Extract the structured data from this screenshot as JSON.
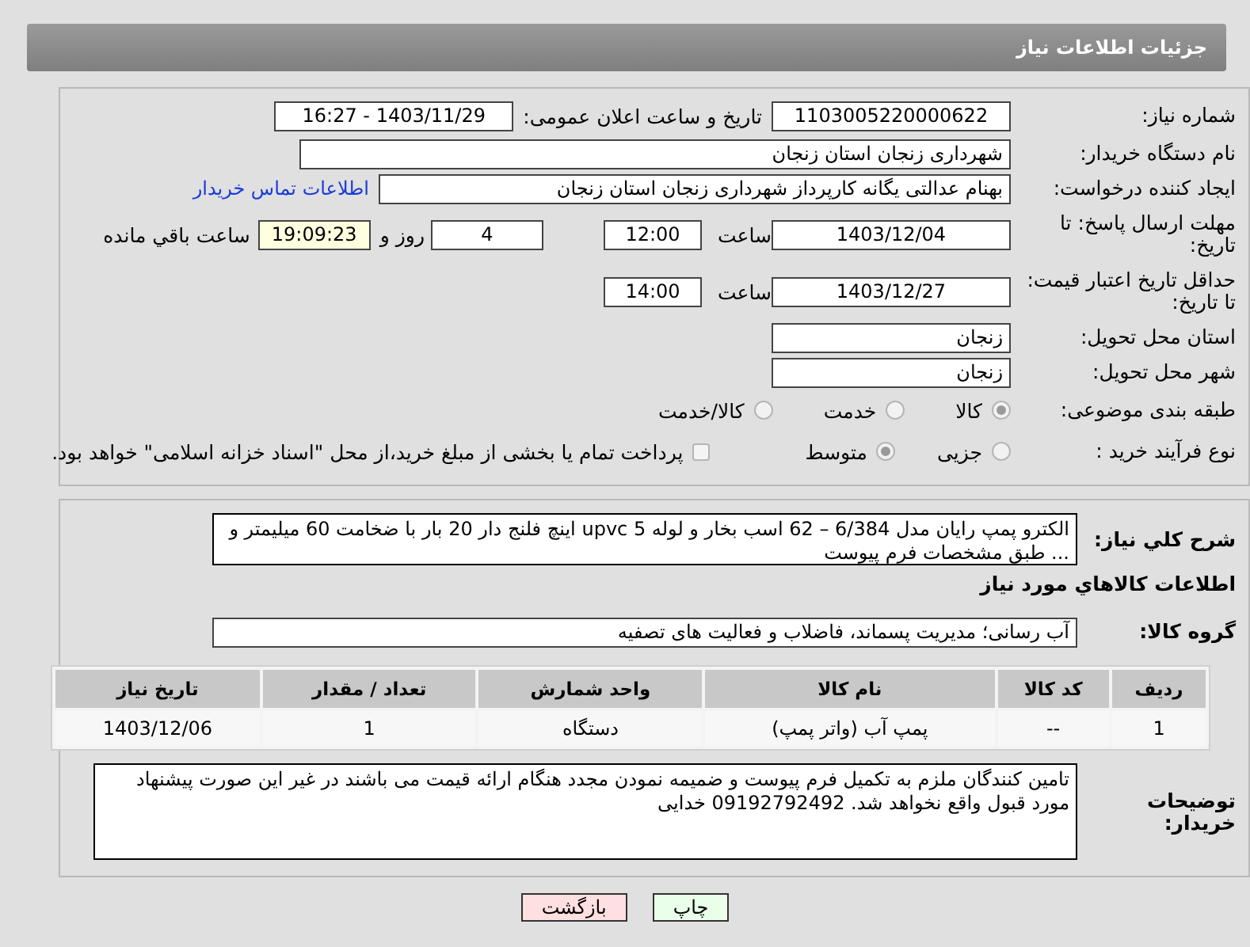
{
  "header": {
    "title": "جزئیات اطلاعات نیاز"
  },
  "need_number": {
    "label": "شماره نیاز:",
    "value": "1103005220000622"
  },
  "announce_datetime": {
    "label": "تاریخ و ساعت اعلان عمومی:",
    "value": "1403/11/29 - 16:27"
  },
  "buyer_org": {
    "label": "نام دستگاه خریدار:",
    "value": "شهرداری زنجان استان زنجان"
  },
  "requester": {
    "label": "ایجاد کننده درخواست:",
    "value": "بهنام عدالتی یگانه کارپرداز شهرداری زنجان استان زنجان",
    "link": "اطلاعات تماس خریدار"
  },
  "reply_deadline": {
    "label": "مهلت ارسال پاسخ: تا تاریخ:",
    "date": "1403/12/04",
    "time_label": "ساعت",
    "time": "12:00",
    "days": "4",
    "days_label": "روز و",
    "remaining": "19:09:23",
    "remaining_label": "ساعت باقي مانده"
  },
  "price_validity": {
    "label": "حداقل تاریخ اعتبار قیمت: تا تاریخ:",
    "date": "1403/12/27",
    "time_label": "ساعت",
    "time": "14:00"
  },
  "delivery_province": {
    "label": "استان محل تحویل:",
    "value": "زنجان"
  },
  "delivery_city": {
    "label": "شهر محل تحویل:",
    "value": "زنجان"
  },
  "category": {
    "label": "طبقه بندی موضوعی:",
    "options": [
      {
        "label": "کالا",
        "selected": true
      },
      {
        "label": "خدمت",
        "selected": false
      },
      {
        "label": "کالا/خدمت",
        "selected": false
      }
    ]
  },
  "purchase_process": {
    "label": "نوع فرآیند خرید :",
    "options": [
      {
        "label": "جزیی",
        "selected": false
      },
      {
        "label": "متوسط",
        "selected": true
      }
    ],
    "treasury": {
      "checked": false,
      "label": "پرداخت تمام یا بخشی از مبلغ خرید،از محل \"اسناد خزانه اسلامی\" خواهد بود."
    }
  },
  "summary": {
    "label": "شرح کلي نياز:",
    "value": "الکترو پمپ رایان مدل 6/384 – 62 اسب بخار  و لوله upvc 5 اینچ فلنج دار 20 بار با ضخامت 60 میلیمتر و ... طبق مشخصات فرم پیوست"
  },
  "goods_heading": "اطلاعات کالاهاي مورد نياز",
  "goods_group": {
    "label": "گروه کالا:",
    "value": "آب رسانی؛ مدیریت پسماند، فاضلاب و فعالیت های تصفیه"
  },
  "table": {
    "columns": [
      "ردیف",
      "کد کالا",
      "نام کالا",
      "واحد شمارش",
      "تعداد / مقدار",
      "تاریخ نیاز"
    ],
    "rows": [
      [
        "1",
        "--",
        "پمپ آب (واتر پمپ)",
        "دستگاه",
        "1",
        "1403/12/06"
      ]
    ]
  },
  "buyer_notes": {
    "label": "توضیحات خریدار:",
    "value": "تامین کنندگان ملزم به تکمیل فرم پیوست و ضمیمه نمودن مجدد هنگام ارائه قیمت می باشند در غیر این صورت پیشنهاد مورد قبول واقع نخواهد شد. 09192792492 خدایی"
  },
  "buttons": [
    {
      "label": "چاپ",
      "kind": "print"
    },
    {
      "label": "بازگشت",
      "kind": "back"
    }
  ]
}
